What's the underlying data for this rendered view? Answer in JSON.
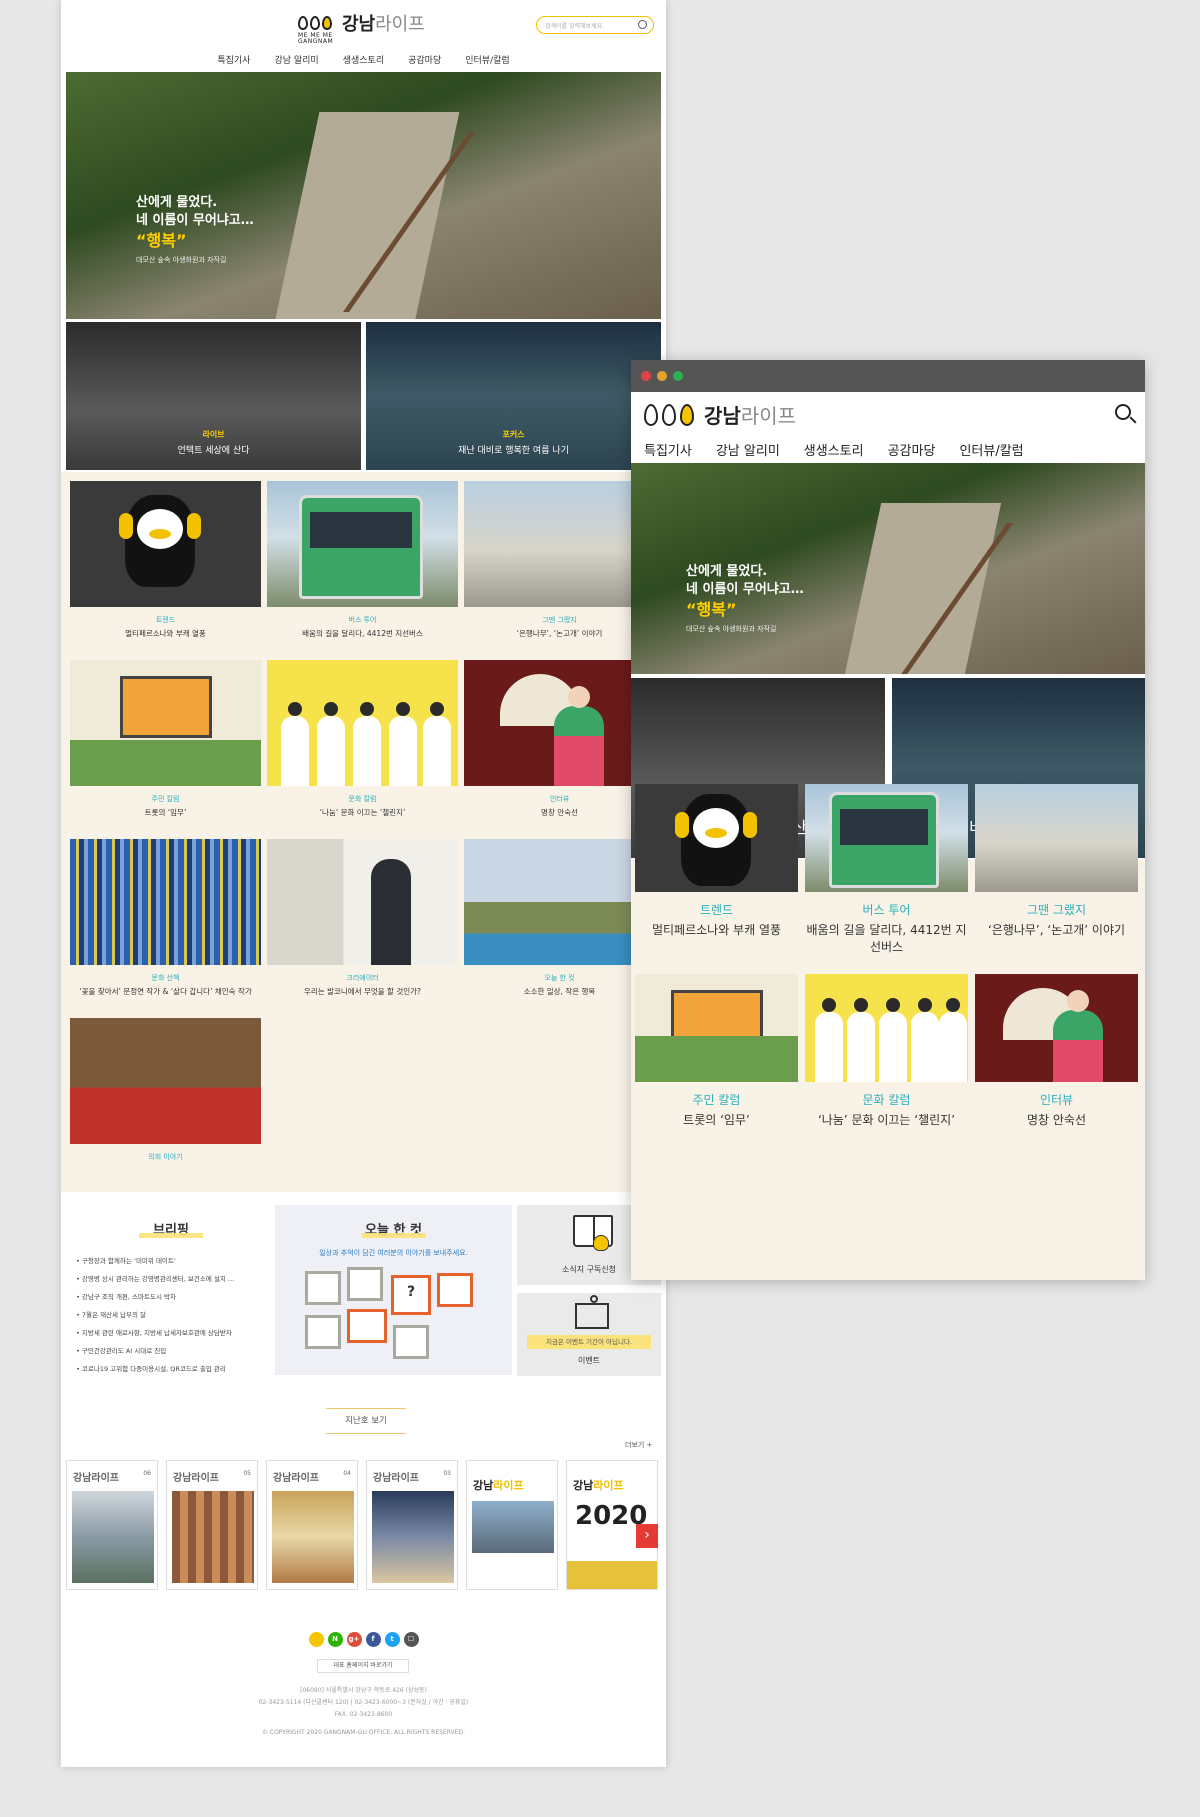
{
  "site": {
    "logo_sub": "ME ME ME GANGNAM",
    "logo_main": "강남",
    "logo_accent": "라이프",
    "search_placeholder": "검색어를 입력해보세요."
  },
  "nav": [
    "특집기사",
    "강남 알리미",
    "생생스토리",
    "공감마당",
    "인터뷰/칼럼"
  ],
  "hero": {
    "line1": "산에게 물었다.",
    "line2": "네 이름이 무어냐고…",
    "line3": "“행복”",
    "caption": "대모산 숲속 야생화원과 자작길"
  },
  "features": [
    {
      "category": "라이브",
      "title": "언택트 세상에 산다"
    },
    {
      "category": "포커스",
      "title": "재난 대비로 행복한 여름 나기"
    }
  ],
  "cards": [
    {
      "category": "트렌드",
      "title": "멀티페르소나와 부캐 열풍"
    },
    {
      "category": "버스 투어",
      "title": "배움의 길을 달리다, 4412번 지선버스"
    },
    {
      "category": "그땐 그랬지",
      "title": "‘은행나무’, ‘논고개’ 이야기"
    },
    {
      "category": "주민 칼럼",
      "title": "트롯의 ‘임무’"
    },
    {
      "category": "문화 칼럼",
      "title": "‘나눔’ 문화 이끄는 ‘챌린지’"
    },
    {
      "category": "인터뷰",
      "title": "명창 안숙선"
    },
    {
      "category": "문화 산책",
      "title": "‘꽃을 찾아서’ 문정연 작가 & ‘살다 갑니다’ 채인숙 작가"
    },
    {
      "category": "크리에이터",
      "title": "우리는 발코니에서 무엇을 할 것인가?"
    },
    {
      "category": "오늘 한 컷",
      "title": "소소한 일상, 작은 행복"
    },
    {
      "category": "의회 이야기",
      "title": ""
    }
  ],
  "briefing": {
    "heading": "브리핑",
    "items": [
      "구청장과 함께하는 ‘미미위 데이트’",
      "강영병 상시 관리하는 강영병관리센터, 보건소에 설치 …",
      "강남구 조직 개편, 스마트도시 박차",
      "7월은 재산세 납부의 달",
      "지방세 관련 애로사항, 지방세 납세자보호관에 상담받자",
      "구민건강관리도 AI 시대로 진입",
      "코로나19 고위험 다중이용시설, QR코드로 출입 관리"
    ]
  },
  "oneshot": {
    "heading": "오늘 한 컷",
    "sub": "일상과 추억이 담긴 여러분의 이야기를 보내주세요.",
    "q": "?"
  },
  "side": {
    "subscribe": "소식지 구독신청",
    "event_note": "지금은 이벤트 기간이 아닙니다.",
    "event": "이벤트"
  },
  "archive": {
    "button": "지난호 보기",
    "more": "더보기 +",
    "issues": [
      {
        "title": "강남라이프",
        "no": "06"
      },
      {
        "title": "강남라이프",
        "no": "05"
      },
      {
        "title": "강남라이프",
        "no": "04"
      },
      {
        "title": "강남라이프",
        "no": "03"
      }
    ],
    "covers": [
      {
        "main": "강남",
        "accent": "라이프"
      },
      {
        "main": "강남",
        "accent": "라이프",
        "big": "2020"
      }
    ],
    "next": "›"
  },
  "footer": {
    "socials": [
      "",
      "N",
      "g+",
      "f",
      "t",
      "☐"
    ],
    "home_button": "대표 홈페이지 바로가기",
    "address": "[06090] 서울특별시 강남구 학동로 426 (삼성동)",
    "phone": "02-3423-5114 (다산콜센터 120) | 02-3423-6000~3 (문자실 / 야간 · 공휴일)",
    "fax": "FAX. 02-3423-8600",
    "copyright": "© COPYRIGHT 2020 GANGNAM-GU OFFICE. ALL RIGHTS RESERVED."
  },
  "browser": {
    "dot_colors": [
      "#e0443e",
      "#e0a52b",
      "#2cb24a"
    ]
  },
  "colors": {
    "accent_yellow": "#f5c400",
    "category_teal": "#2ab0bd",
    "cream_bg": "#f8f2e7"
  }
}
